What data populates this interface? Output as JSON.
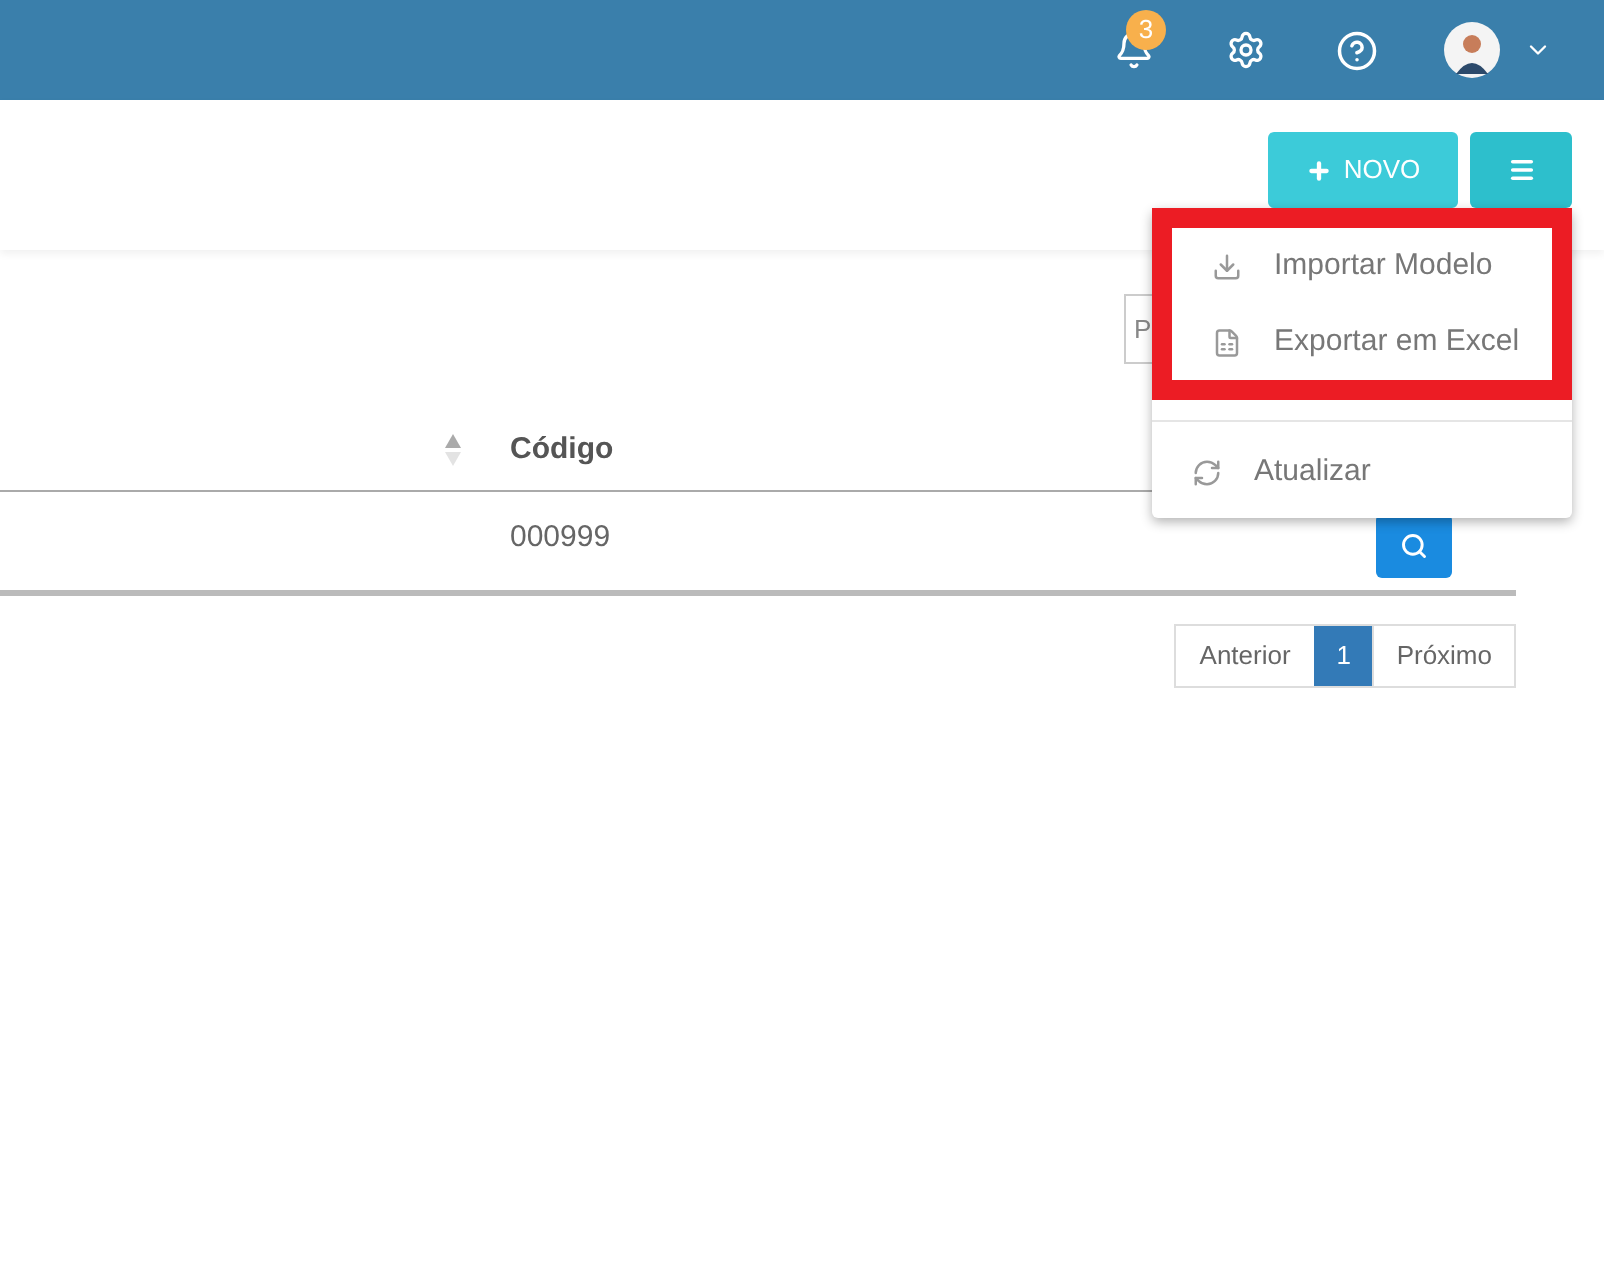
{
  "header": {
    "notifications": {
      "count": "3"
    }
  },
  "toolbar": {
    "new_button": "NOVO"
  },
  "menu": {
    "items": [
      {
        "kind": "import",
        "label": "Importar Modelo",
        "highlighted": true
      },
      {
        "kind": "excel",
        "label": "Exportar em Excel",
        "highlighted": true
      },
      {
        "kind": "refresh",
        "label": "Atualizar",
        "highlighted": false
      }
    ]
  },
  "search": {
    "placeholder": "P"
  },
  "table": {
    "columns": [
      "Código"
    ],
    "rows": [
      {
        "code": "000999"
      }
    ]
  },
  "pagination": {
    "previous": "Anterior",
    "pages": [
      {
        "label": "1",
        "selected": true
      }
    ],
    "next": "Próximo"
  }
}
